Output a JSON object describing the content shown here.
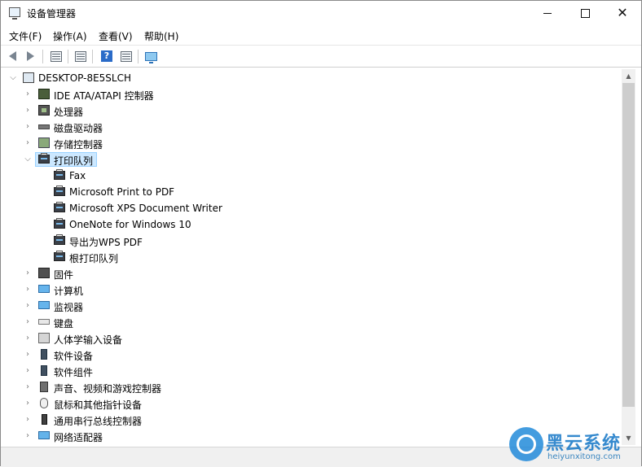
{
  "window": {
    "title": "设备管理器"
  },
  "menubar": {
    "items": [
      "文件(F)",
      "操作(A)",
      "查看(V)",
      "帮助(H)"
    ]
  },
  "tree": {
    "root": "DESKTOP-8E5SLCH",
    "categories": [
      "IDE ATA/ATAPI 控制器",
      "处理器",
      "磁盘驱动器",
      "存储控制器",
      "打印队列",
      "固件",
      "计算机",
      "监视器",
      "键盘",
      "人体学输入设备",
      "软件设备",
      "软件组件",
      "声音、视频和游戏控制器",
      "鼠标和其他指针设备",
      "通用串行总线控制器",
      "网络适配器"
    ],
    "print_queue_children": [
      "Fax",
      "Microsoft Print to PDF",
      "Microsoft XPS Document Writer",
      "OneNote for Windows 10",
      "导出为WPS PDF",
      "根打印队列"
    ]
  },
  "watermark": {
    "brand": "黑云系统",
    "url": "heiyunxitong.com"
  }
}
